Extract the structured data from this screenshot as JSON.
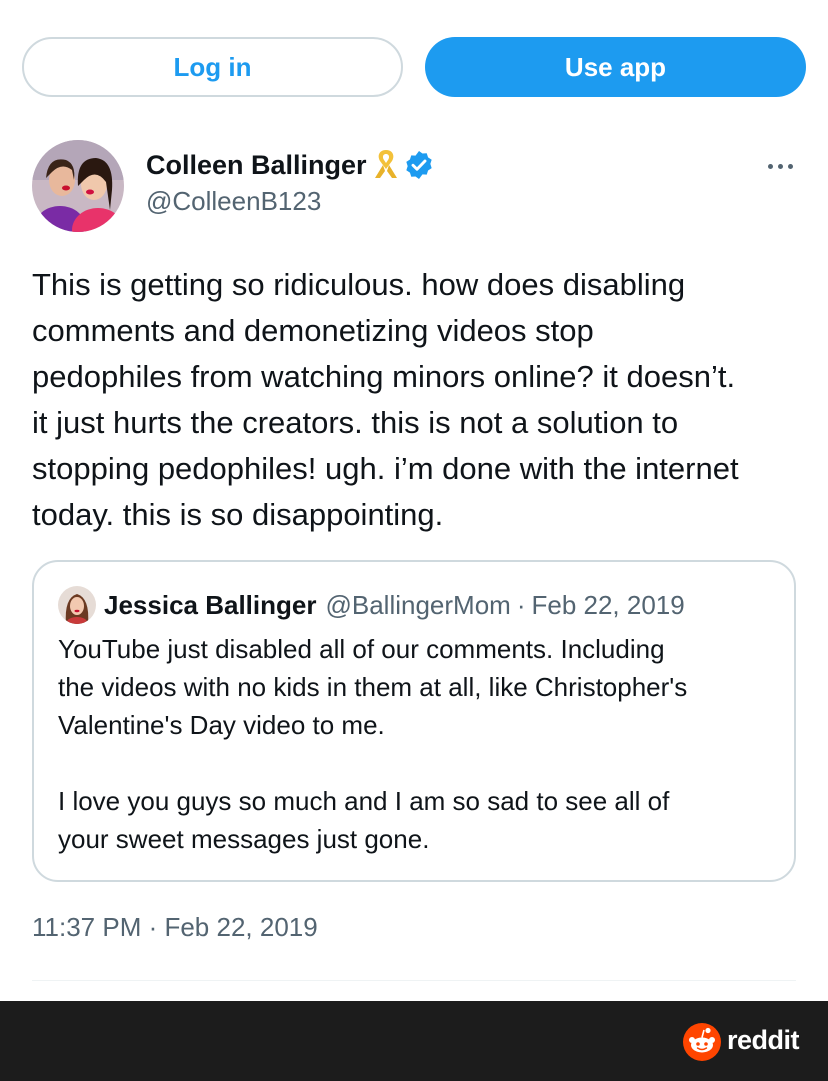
{
  "top_bar": {
    "login_label": "Log in",
    "use_app_label": "Use app"
  },
  "tweet": {
    "author_name": "Colleen Ballinger",
    "author_handle": "@ColleenB123",
    "text": "This is getting so ridiculous. how does disabling\ncomments and demonetizing videos stop\npedophiles from watching minors online? it doesn’t.\nit just hurts the creators. this is not a solution to\nstopping pedophiles! ugh. i’m done with the internet\ntoday. this is so disappointing.",
    "timestamp": "11:37 PM · Feb 22, 2019"
  },
  "quote": {
    "author_name": "Jessica Ballinger",
    "author_handle": "@BallingerMom",
    "separator": "·",
    "date": "Feb 22, 2019",
    "text": "YouTube just disabled all of our comments. Including\nthe videos with no kids in them at all, like Christopher's\nValentine's Day video to me.\n\nI love you guys so much and I am so sad to see all of\nyour sweet messages just gone."
  },
  "footer": {
    "brand": "reddit"
  },
  "colors": {
    "accent": "#1d9bf0",
    "muted_text": "#536471",
    "footer_bg": "#1c1c1c",
    "reddit_orange": "#ff4500"
  },
  "icons": [
    "avatar-photo",
    "awareness-ribbon-icon",
    "verified-badge-icon",
    "more-options-icon",
    "reddit-logo-icon"
  ]
}
